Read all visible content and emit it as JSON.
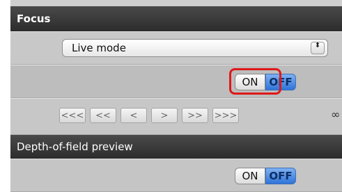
{
  "focus": {
    "title": "Focus",
    "mode_select": {
      "value": "Live mode",
      "arrow": "⬍"
    },
    "af_toggle": {
      "on_label": "ON",
      "off_label": "OFF",
      "selected": "OFF"
    },
    "stepper": {
      "labels": [
        "<<<",
        "<<",
        "<",
        ">",
        ">>",
        ">>>"
      ],
      "end_glyph": "∞"
    }
  },
  "dof_preview": {
    "title": "Depth-of-field preview",
    "toggle": {
      "on_label": "ON",
      "off_label": "OFF",
      "selected": "OFF"
    }
  },
  "colors": {
    "header_bg": "#2c2c2c",
    "off_blue": "#2f74d8",
    "highlight_red": "#e01818"
  }
}
